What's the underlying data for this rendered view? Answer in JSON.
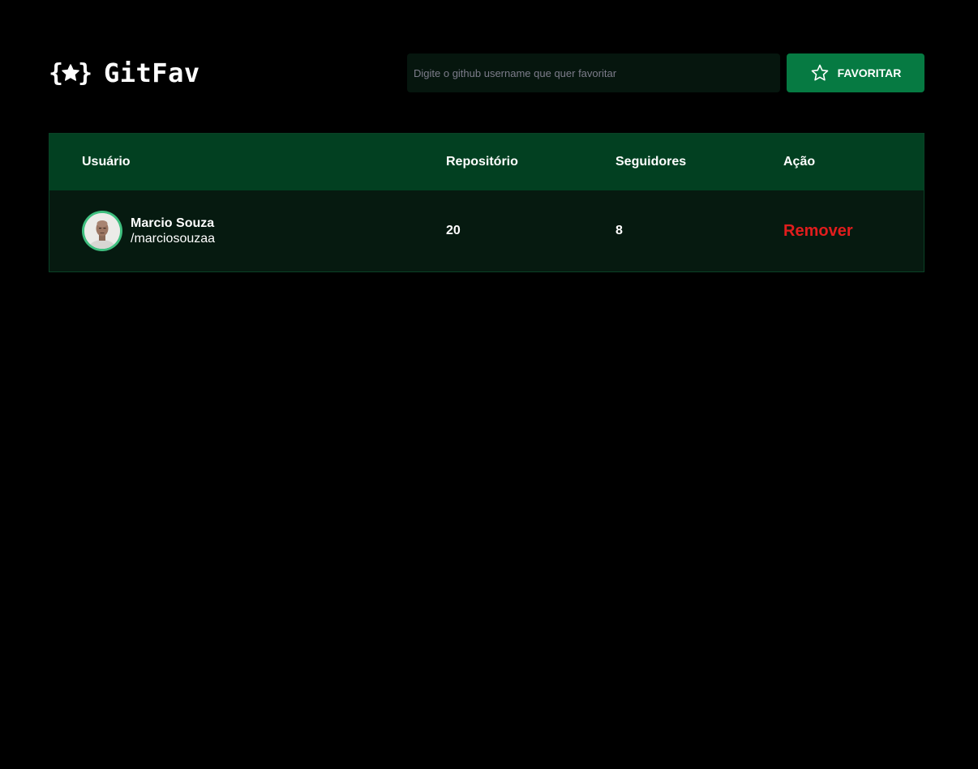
{
  "app": {
    "title": "GitFav",
    "logo_icon": "star-in-braces-icon"
  },
  "search": {
    "placeholder": "Digite o github username que quer favoritar",
    "value": "",
    "button_label": "FAVORITAR",
    "button_icon": "star-outline-icon"
  },
  "table": {
    "headers": {
      "user": "Usuário",
      "repos": "Repositório",
      "followers": "Seguidores",
      "action": "Ação"
    },
    "rows": [
      {
        "name": "Marcio Souza",
        "login": "/marciosouzaa",
        "repos": "20",
        "followers": "8",
        "action": "Remover"
      }
    ]
  },
  "colors": {
    "background": "#000000",
    "header_row": "#024021",
    "body_row": "#061a10",
    "button": "#067a42",
    "remove": "#e11d1d",
    "input_bg": "#06160e"
  }
}
